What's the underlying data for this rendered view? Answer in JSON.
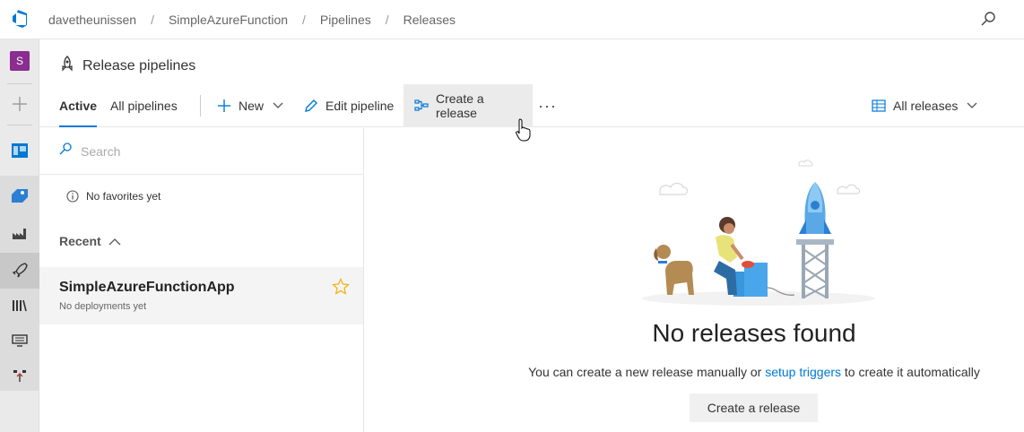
{
  "header": {
    "breadcrumbs": [
      "davetheunissen",
      "SimpleAzureFunction",
      "Pipelines",
      "Releases"
    ],
    "separator": "/"
  },
  "rail": {
    "avatar_letter": "S",
    "items": [
      "overview-icon",
      "boards-icon",
      "repos-icon",
      "pipelines-icon",
      "releases-icon",
      "library-icon",
      "task-groups-icon",
      "deployment-groups-icon"
    ]
  },
  "page": {
    "title": "Release pipelines"
  },
  "toolbar": {
    "tab_active": "Active",
    "tab_all": "All pipelines",
    "new_label": "New",
    "edit_label": "Edit pipeline",
    "create_label": "Create a release",
    "more_label": "···",
    "filter_label": "All releases"
  },
  "left": {
    "search_placeholder": "Search",
    "no_favorites": "No favorites yet",
    "recent_label": "Recent",
    "pipelines": [
      {
        "name": "SimpleAzureFunctionApp",
        "status": "No deployments yet"
      }
    ]
  },
  "empty": {
    "title": "No releases found",
    "desc_before": "You can create a new release manually or ",
    "desc_link": "setup triggers",
    "desc_after": " to create it automatically",
    "button": "Create a release"
  },
  "colors": {
    "accent": "#0078d4",
    "avatar": "#8a2d8e",
    "star": "#f2b318"
  }
}
